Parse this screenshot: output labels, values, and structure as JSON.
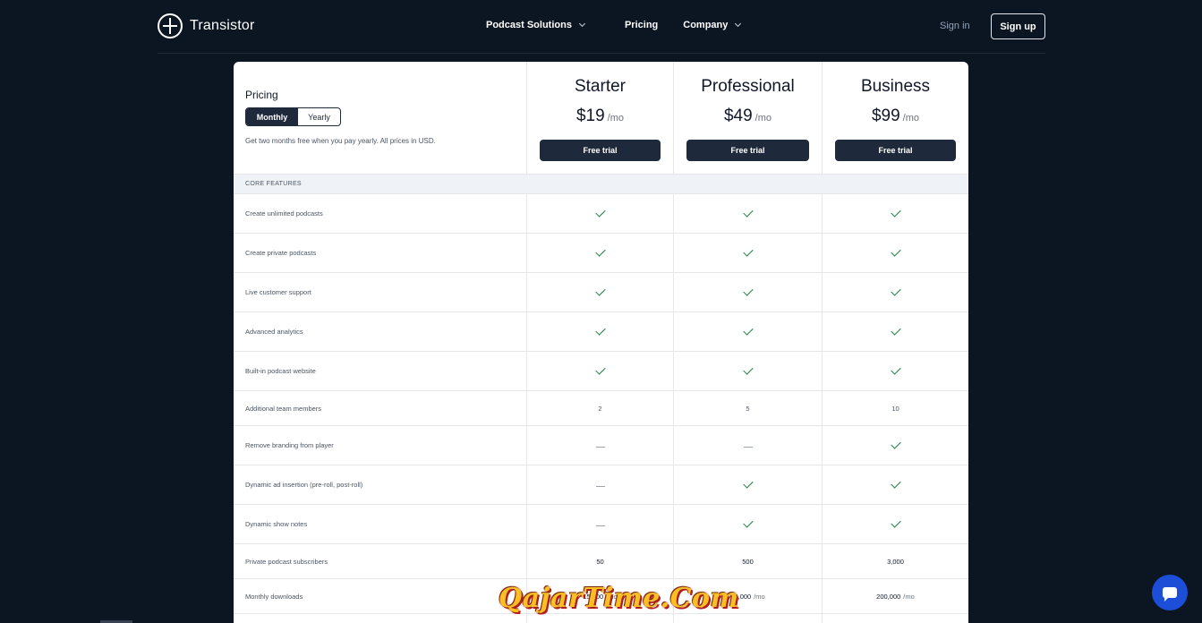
{
  "nav": {
    "brand": "Transistor",
    "links": [
      {
        "label": "Podcast Solutions",
        "has_menu": true
      },
      {
        "label": "Pricing",
        "has_menu": false
      },
      {
        "label": "Company",
        "has_menu": true
      }
    ],
    "sign_in": "Sign in",
    "sign_up": "Sign up"
  },
  "pricing": {
    "title": "Pricing",
    "toggle": {
      "monthly": "Monthly",
      "yearly": "Yearly",
      "selected": "Monthly"
    },
    "note": "Get two months free when you pay yearly. All prices in USD."
  },
  "plans": [
    {
      "name": "Starter",
      "price": "$19",
      "per": "/mo",
      "cta": "Free trial"
    },
    {
      "name": "Professional",
      "price": "$49",
      "per": "/mo",
      "cta": "Free trial"
    },
    {
      "name": "Business",
      "price": "$99",
      "per": "/mo",
      "cta": "Free trial"
    }
  ],
  "section": "CORE FEATURES",
  "features": [
    {
      "label": "Create unlimited podcasts",
      "values": [
        "check",
        "check",
        "check"
      ]
    },
    {
      "label": "Create private podcasts",
      "values": [
        "check",
        "check",
        "check"
      ]
    },
    {
      "label": "Live customer support",
      "values": [
        "check",
        "check",
        "check"
      ]
    },
    {
      "label": "Advanced analytics",
      "values": [
        "check",
        "check",
        "check"
      ]
    },
    {
      "label": "Built-in podcast website",
      "values": [
        "check",
        "check",
        "check"
      ]
    },
    {
      "label": "Additional team members",
      "values": [
        "2",
        "5",
        "10"
      ]
    },
    {
      "label": "Remove branding from player",
      "values": [
        "dash",
        "dash",
        "check"
      ]
    },
    {
      "label": "Dynamic ad insertion (pre-roll, post-roll)",
      "values": [
        "dash",
        "check",
        "check"
      ]
    },
    {
      "label": "Dynamic show notes",
      "values": [
        "dash",
        "check",
        "check"
      ]
    },
    {
      "label": "Private podcast subscribers",
      "values": [
        "50",
        "500",
        "3,000"
      ]
    },
    {
      "label": "Monthly downloads",
      "values": [
        "15,000",
        "75,000",
        "200,000"
      ],
      "unit": "/mo"
    }
  ],
  "watermark": "QajarTime.Com",
  "colors": {
    "background": "#0c1522",
    "button": "#1e293b",
    "check": "#15803d",
    "chat": "#1d4ed8"
  },
  "icons": {
    "check": "check-icon",
    "dash": "dash-icon",
    "chat": "chat-icon",
    "chevron": "chevron-down-icon"
  }
}
